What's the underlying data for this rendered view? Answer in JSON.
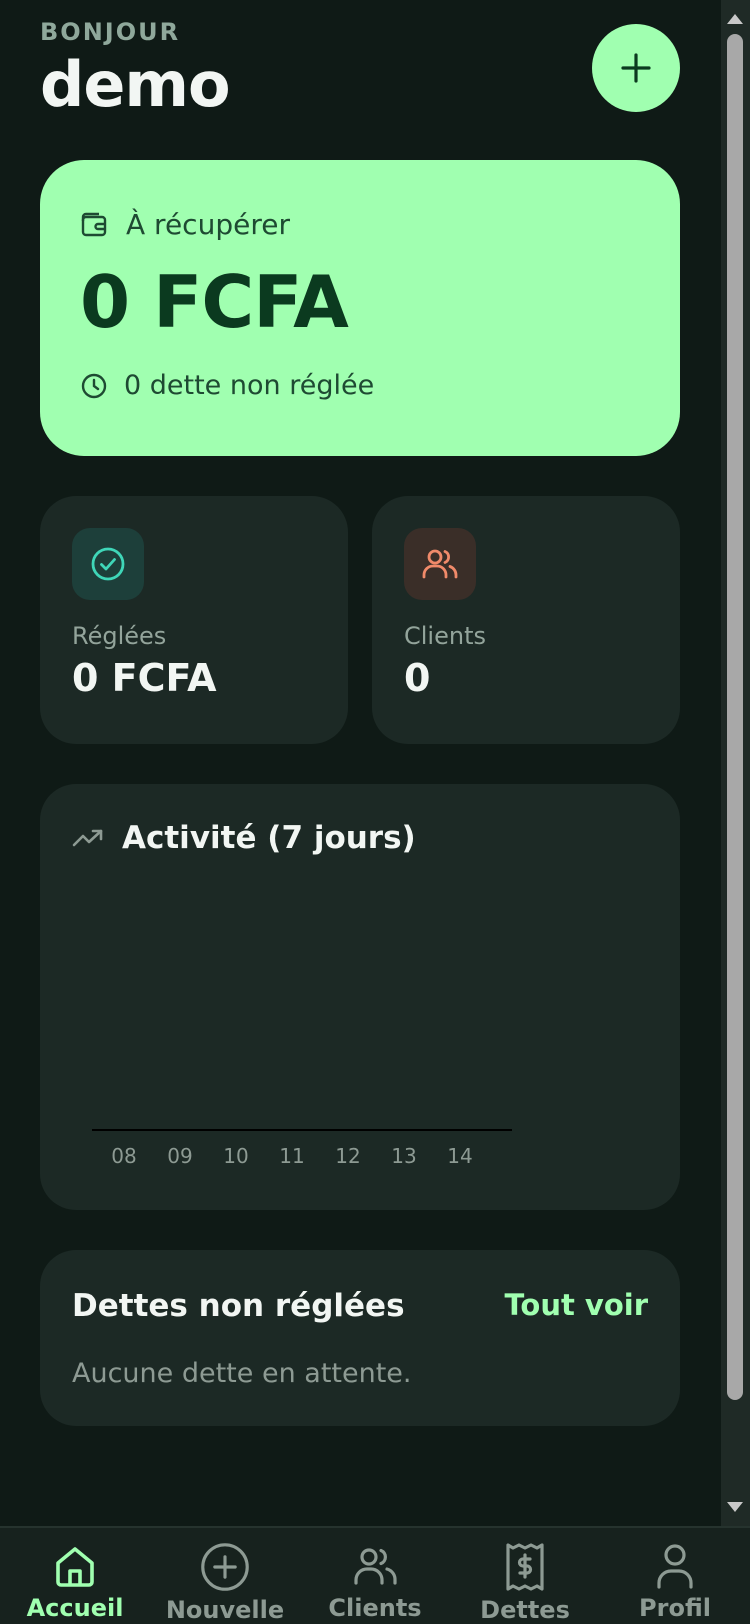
{
  "header": {
    "greeting": "BONJOUR",
    "user_name": "demo"
  },
  "hero": {
    "label": "À récupérer",
    "amount": "0 FCFA",
    "subtitle": "0 dette non réglée"
  },
  "stats": {
    "settled": {
      "label": "Réglées",
      "value": "0 FCFA",
      "icon": "check-circle-icon",
      "accent": "#3fd6b8"
    },
    "clients": {
      "label": "Clients",
      "value": "0",
      "icon": "users-icon",
      "accent": "#f08a6a"
    }
  },
  "activity": {
    "title": "Activité (7 jours)",
    "icon": "trending-up-icon"
  },
  "chart_data": {
    "type": "bar",
    "categories": [
      "08",
      "09",
      "10",
      "11",
      "12",
      "13",
      "14"
    ],
    "values": [
      0,
      0,
      0,
      0,
      0,
      0,
      0
    ],
    "title": "Activité (7 jours)",
    "xlabel": "",
    "ylabel": "",
    "grid": false,
    "legend": "none"
  },
  "debts": {
    "title": "Dettes non réglées",
    "link": "Tout voir",
    "empty": "Aucune dette en attente."
  },
  "nav": {
    "items": [
      {
        "label": "Accueil",
        "icon": "home-icon",
        "active": true
      },
      {
        "label": "Nouvelle",
        "icon": "plus-circle-icon",
        "active": false
      },
      {
        "label": "Clients",
        "icon": "users-icon",
        "active": false
      },
      {
        "label": "Dettes",
        "icon": "receipt-icon",
        "active": false
      },
      {
        "label": "Profil",
        "icon": "user-icon",
        "active": false
      }
    ]
  },
  "colors": {
    "background": "#0f1a16",
    "card": "#1c2925",
    "accent": "#a0ffb0",
    "accent_dark": "#0b3a1f",
    "muted": "#8d9a93"
  }
}
